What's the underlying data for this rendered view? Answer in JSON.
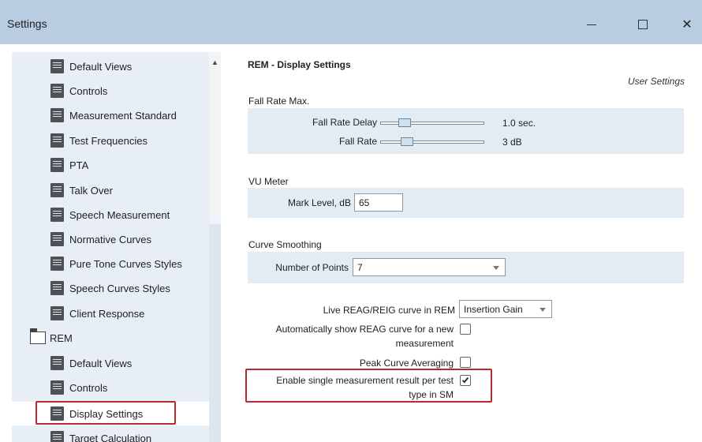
{
  "window": {
    "title": "Settings",
    "minimize_glyph": "—",
    "maximize_glyph": "☐",
    "close_glyph": "✕"
  },
  "tree": {
    "scroll_up_glyph": "▲",
    "items": [
      {
        "label": "Default Views",
        "icon": "document-icon"
      },
      {
        "label": "Controls",
        "icon": "document-icon"
      },
      {
        "label": "Measurement Standard",
        "icon": "document-icon"
      },
      {
        "label": "Test Frequencies",
        "icon": "document-icon"
      },
      {
        "label": "PTA",
        "icon": "document-icon"
      },
      {
        "label": "Talk Over",
        "icon": "document-icon"
      },
      {
        "label": "Speech Measurement",
        "icon": "document-icon"
      },
      {
        "label": "Normative Curves",
        "icon": "document-icon"
      },
      {
        "label": "Pure Tone Curves Styles",
        "icon": "document-icon"
      },
      {
        "label": "Speech Curves Styles",
        "icon": "document-icon"
      },
      {
        "label": "Client Response",
        "icon": "document-icon"
      },
      {
        "label": "REM",
        "icon": "folder-icon"
      },
      {
        "label": "Default Views",
        "icon": "document-icon"
      },
      {
        "label": "Controls",
        "icon": "document-icon"
      },
      {
        "label": "Display Settings",
        "icon": "document-icon",
        "selected": true
      },
      {
        "label": "Target Calculation",
        "icon": "document-icon"
      }
    ]
  },
  "content": {
    "title": "REM - Display Settings",
    "user_settings": "User Settings",
    "fall_rate": {
      "group_label": "Fall Rate Max.",
      "delay_label": "Fall Rate Delay",
      "delay_value": "1.0 sec.",
      "delay_level": 0.2,
      "rate_label": "Fall Rate",
      "rate_value": "3 dB",
      "rate_level": 0.22
    },
    "vu_meter": {
      "group_label": "VU Meter",
      "mark_label": "Mark Level, dB",
      "mark_value": "65"
    },
    "curve_smoothing": {
      "group_label": "Curve Smoothing",
      "points_label": "Number of Points",
      "points_value": "7"
    },
    "options": {
      "live_label": "Live REAG/REIG curve in REM",
      "live_value": "Insertion Gain",
      "auto_label_1": "Automatically show REAG curve for a new",
      "auto_label_2": "measurement",
      "auto_checked": false,
      "peak_label": "Peak Curve Averaging",
      "peak_checked": false,
      "single_label_1": "Enable single measurement result per test",
      "single_label_2": "type in SM",
      "single_checked": true
    }
  },
  "colors": {
    "titlebar": "#b8cde0",
    "tree_bg": "#e7eef5",
    "group_bg": "#e4ecf3",
    "highlight": "#b5292f"
  }
}
